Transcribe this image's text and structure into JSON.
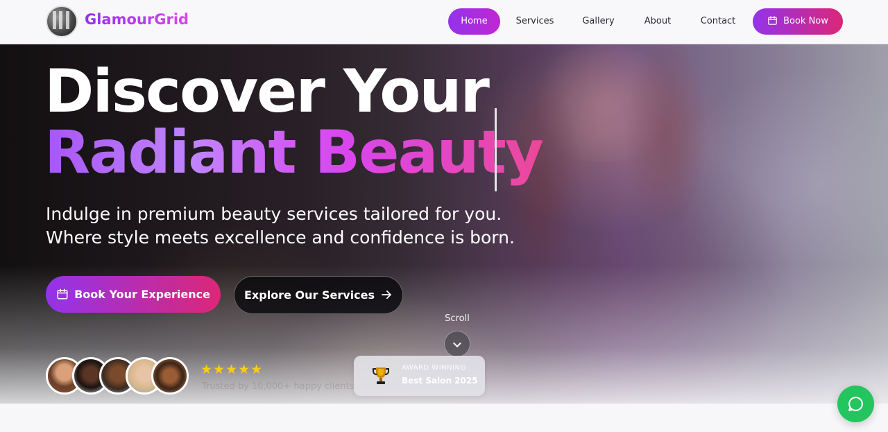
{
  "brand": {
    "name": "GlamourGrid",
    "gradient_start": "#9333ea",
    "gradient_end": "#d946ef"
  },
  "nav": {
    "items": [
      {
        "label": "Home",
        "active": true
      },
      {
        "label": "Services"
      },
      {
        "label": "Gallery"
      },
      {
        "label": "About"
      },
      {
        "label": "Contact"
      }
    ],
    "cta": {
      "label": "Book Now",
      "icon": "calendar-icon"
    }
  },
  "hero": {
    "title_line1": "Discover Your",
    "title_line2": "Radiant Beauty",
    "subtitle_line1": "Indulge in premium beauty services tailored for you.",
    "subtitle_line2": "Where style meets excellence and confidence is born.",
    "primary_button": {
      "label": "Book Your Experience",
      "icon": "calendar-icon"
    },
    "secondary_button": {
      "label": "Explore Our Services",
      "icon": "arrow-right-icon"
    }
  },
  "scroll": {
    "label": "Scroll",
    "icon": "chevron-down-icon"
  },
  "social_proof": {
    "avatars": [
      "avatar-1",
      "avatar-2",
      "avatar-3",
      "avatar-4",
      "avatar-5"
    ],
    "rating_stars": 5,
    "stars_text": "★★★★★",
    "caption": "Trusted by 10,000+ happy clients"
  },
  "award": {
    "top_text": "AWARD WINNING",
    "main_text": "Best Salon 2025",
    "icon": "trophy-icon"
  },
  "chat": {
    "icon": "chat-bubble-icon",
    "color": "#22c55e"
  },
  "colors": {
    "accent_purple": "#9333ea",
    "accent_pink": "#db2777",
    "star_yellow": "#facc15"
  }
}
